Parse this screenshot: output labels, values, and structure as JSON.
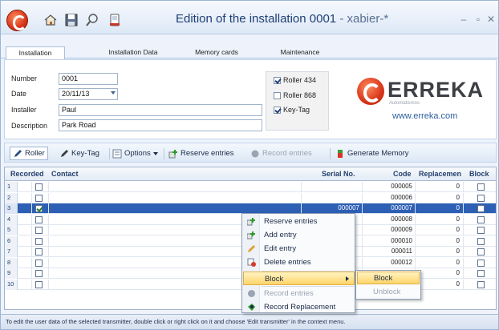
{
  "window": {
    "title": "Edition of the installation 0001",
    "title_user": " - xabier-*",
    "minimize": "–",
    "restore": "▫",
    "close": "✕"
  },
  "tabs": [
    "Installation",
    "Installation Data",
    "Memory cards",
    "Maintenance"
  ],
  "form": {
    "number_label": "Number",
    "number_value": "0001",
    "date_label": "Date",
    "date_value": "20/11/13",
    "installer_label": "Installer",
    "installer_value": "Paul",
    "description_label": "Description",
    "description_value": "Park Road"
  },
  "options": [
    {
      "label": "Roller 434",
      "checked": true
    },
    {
      "label": "Roller 868",
      "checked": false
    },
    {
      "label": "Key-Tag",
      "checked": true
    }
  ],
  "brand": {
    "name": "ERREKA",
    "tagline": "Automatismos",
    "url": "www.erreka.com"
  },
  "toolbar": {
    "roller": "Roller",
    "keytag": "Key-Tag",
    "options": "Options",
    "reserve": "Reserve entries",
    "record": "Record entries",
    "generate": "Generate Memory"
  },
  "grid": {
    "headers": [
      "Recorded",
      "Contact",
      "Serial No.",
      "Code",
      "Replacemen",
      "Block"
    ],
    "rows": [
      {
        "n": "1",
        "recorded": false,
        "serial": "",
        "code": "000005",
        "repl": "0"
      },
      {
        "n": "2",
        "recorded": false,
        "serial": "",
        "code": "000006",
        "repl": "0"
      },
      {
        "n": "3",
        "recorded": true,
        "serial": "000007",
        "code": "000007",
        "repl": "0",
        "selected": true
      },
      {
        "n": "4",
        "recorded": false,
        "serial": "",
        "code": "000008",
        "repl": "0"
      },
      {
        "n": "5",
        "recorded": false,
        "serial": "",
        "code": "000009",
        "repl": "0"
      },
      {
        "n": "6",
        "recorded": false,
        "serial": "",
        "code": "000010",
        "repl": "0"
      },
      {
        "n": "7",
        "recorded": false,
        "serial": "",
        "code": "000011",
        "repl": "0"
      },
      {
        "n": "8",
        "recorded": false,
        "serial": "",
        "code": "000012",
        "repl": "0"
      },
      {
        "n": "9",
        "recorded": false,
        "serial": "",
        "code": "",
        "repl": "0"
      },
      {
        "n": "10",
        "recorded": false,
        "serial": "",
        "code": "",
        "repl": "0"
      }
    ]
  },
  "context_menu": {
    "items": [
      "Reserve entries",
      "Add entry",
      "Edit entry",
      "Delete entries",
      "Block",
      "Record entries",
      "Record Replacement"
    ],
    "submenu": [
      "Block",
      "Unblock"
    ]
  },
  "status": "To edit the user data of the selected transmitter, double click or right click on it and choose 'Edit transmitter' in the context menu."
}
